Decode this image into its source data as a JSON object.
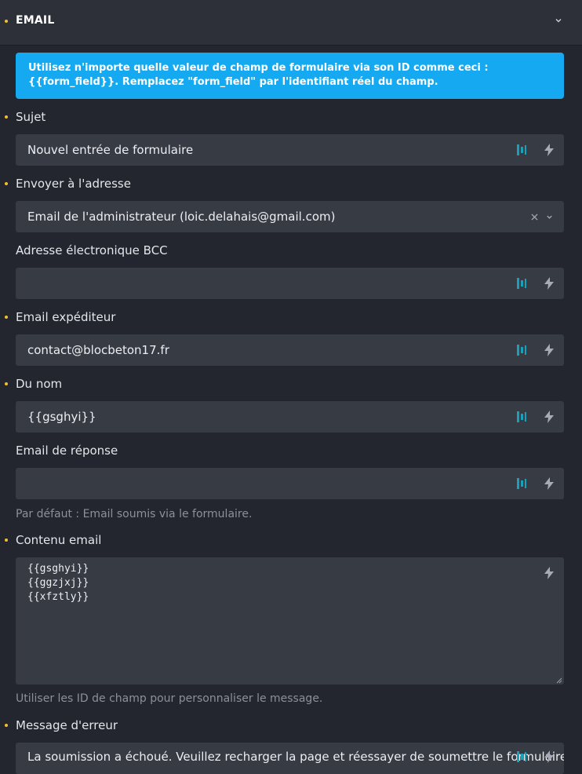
{
  "section": {
    "title": "EMAIL"
  },
  "info": {
    "text": "Utilisez n'importe quelle valeur de champ de formulaire via son ID comme ceci : {{form_field}}. Remplacez \"form_field\" par l'identifiant réel du champ."
  },
  "fields": {
    "subject": {
      "label": "Sujet",
      "value": "Nouvel entrée de formulaire"
    },
    "send_to": {
      "label": "Envoyer à l'adresse",
      "value": "Email de l'administrateur (loic.delahais@gmail.com)"
    },
    "bcc": {
      "label": "Adresse électronique BCC",
      "value": ""
    },
    "from_email": {
      "label": "Email expéditeur",
      "value": "contact@blocbeton17.fr"
    },
    "from_name": {
      "label": "Du nom",
      "value": "{{gsghyi}}"
    },
    "reply_to": {
      "label": "Email de réponse",
      "value": "",
      "hint": "Par défaut : Email soumis via le formulaire."
    },
    "content": {
      "label": "Contenu email",
      "value": "{{gsghyi}}\n{{ggzjxj}}\n{{xfztly}}",
      "hint": "Utiliser les ID de champ pour personnaliser le message."
    },
    "error_message": {
      "label": "Message d'erreur",
      "value": "La soumission a échoué. Veuillez recharger la page et réessayer de soumettre le formulaire."
    }
  },
  "colors": {
    "required_dot": "#f2c02c",
    "info_bg": "#14a9f0",
    "field_bg": "#373b44",
    "icon_teal": "#1aa0b8"
  },
  "icons": [
    "chevron-down-icon",
    "dynamic-data-icon",
    "lightning-icon",
    "clear-x-icon",
    "resize-handle-icon"
  ]
}
